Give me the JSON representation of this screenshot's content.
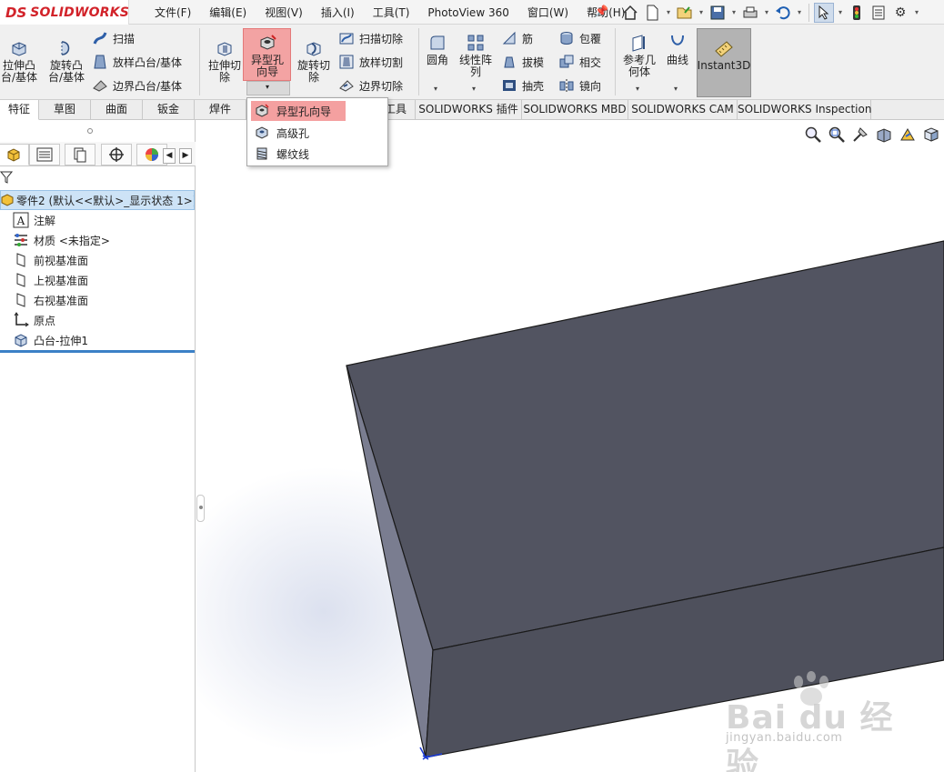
{
  "app": {
    "logo_text": "SOLIDWORKS",
    "logo_mark": "DS"
  },
  "menu": [
    "文件(F)",
    "编辑(E)",
    "视图(V)",
    "插入(I)",
    "工具(T)",
    "PhotoView 360",
    "窗口(W)",
    "帮助(H)"
  ],
  "ribbon": {
    "extrude_boss": "拉伸凸\n台/基体",
    "revolve_boss": "旋转凸\n台/基体",
    "sweep": "扫描",
    "loft_boss": "放样凸台/基体",
    "boundary_boss": "边界凸台/基体",
    "extrude_cut": "拉伸切\n除",
    "hole_wizard": "异型孔\n向导",
    "revolve_cut": "旋转切\n除",
    "sweep_cut": "扫描切除",
    "loft_cut": "放样切割",
    "boundary_cut": "边界切除",
    "fillet": "圆角",
    "linear_pattern": "线性阵\n列",
    "rib": "筋",
    "draft": "拔模",
    "shell": "抽壳",
    "wrap": "包覆",
    "intersect": "相交",
    "mirror": "镜向",
    "ref_geometry": "参考几\n何体",
    "curves": "曲线",
    "instant3d": "Instant3D"
  },
  "tabs": [
    {
      "label": "特征",
      "active": true
    },
    {
      "label": "草图"
    },
    {
      "label": "曲面"
    },
    {
      "label": "钣金"
    },
    {
      "label": "焊件"
    },
    {
      "label": "工具"
    },
    {
      "label": "SOLIDWORKS 插件"
    },
    {
      "label": "SOLIDWORKS MBD"
    },
    {
      "label": "SOLIDWORKS CAM"
    },
    {
      "label": "SOLIDWORKS Inspection"
    }
  ],
  "dropdown": {
    "items": [
      {
        "label": "异型孔向导",
        "highlighted": true
      },
      {
        "label": "高级孔"
      },
      {
        "label": "螺纹线"
      }
    ]
  },
  "tree": {
    "part": "零件2 (默认<<默认>_显示状态 1>)",
    "items": [
      {
        "label": "注解",
        "icon": "annotation-icon"
      },
      {
        "label": "材质 <未指定>",
        "icon": "material-icon"
      },
      {
        "label": "前视基准面",
        "icon": "plane-icon"
      },
      {
        "label": "上视基准面",
        "icon": "plane-icon"
      },
      {
        "label": "右视基准面",
        "icon": "plane-icon"
      },
      {
        "label": "原点",
        "icon": "origin-icon"
      },
      {
        "label": "凸台-拉伸1",
        "icon": "extrude-feature-icon"
      }
    ]
  },
  "watermark": {
    "main": "Bai du 经验",
    "url": "jingyan.baidu.com"
  },
  "colors": {
    "highlight": "#f4a0a0",
    "logo_red": "#d2232a",
    "model_top": "#525461",
    "model_front": "#4e505c",
    "model_side": "#7a7d90",
    "tree_selected": "#cde3f6"
  }
}
